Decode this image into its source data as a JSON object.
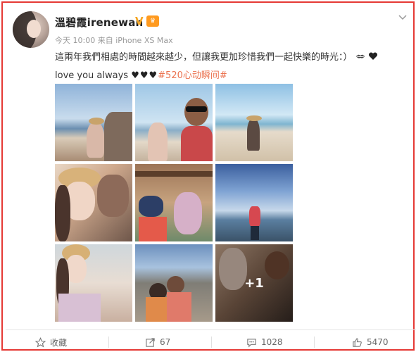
{
  "post": {
    "username": "溫碧霞irenewan",
    "meta": "今天 10:00 来自 iPhone XS Max",
    "text_line1": "這兩年我們相處的時間越來越少，但讓我更加珍惜我們一起快樂的時光：）",
    "text_line2_prefix": "love you always ",
    "hearts": "♥♥♥",
    "hashtag": "#520心动瞬间#",
    "more_photos": "+1"
  },
  "actions": {
    "favorite_label": "收藏",
    "repost_count": "67",
    "comment_count": "1028",
    "like_count": "5470"
  },
  "colors": {
    "frame_border": "#e53935",
    "hashtag": "#eb7350",
    "vip": "#ff9a1f"
  },
  "icons": [
    "chevron-down-icon",
    "verified-icon",
    "vip-icon",
    "star-icon",
    "repost-icon",
    "comment-icon",
    "like-icon",
    "kiss-icon",
    "heart-icon"
  ]
}
